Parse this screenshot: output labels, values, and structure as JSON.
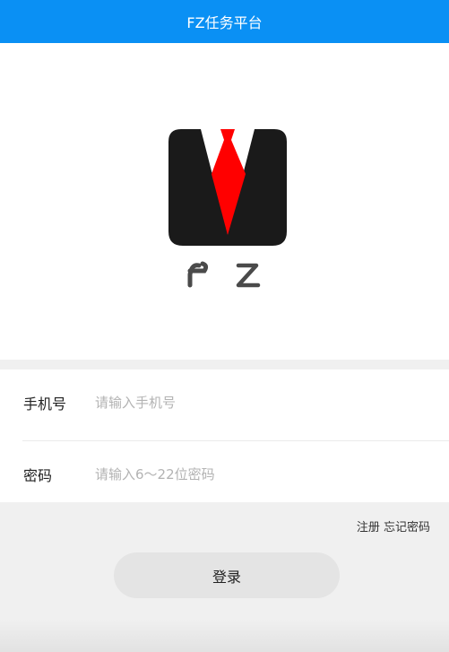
{
  "header": {
    "title": "FZ任务平台"
  },
  "logo": {
    "text": "F Z",
    "brand_color": "#1a1a1a",
    "tie_color": "#ff0000"
  },
  "form": {
    "phone": {
      "label": "手机号",
      "placeholder": "请输入手机号",
      "value": ""
    },
    "password": {
      "label": "密码",
      "placeholder": "请输入6～22位密码",
      "value": ""
    }
  },
  "links": {
    "register": "注册",
    "forgot": "忘记密码"
  },
  "login_button": "登录",
  "colors": {
    "header": "#0a90f4",
    "background": "#f0f0f0",
    "button": "#e4e4e4"
  }
}
